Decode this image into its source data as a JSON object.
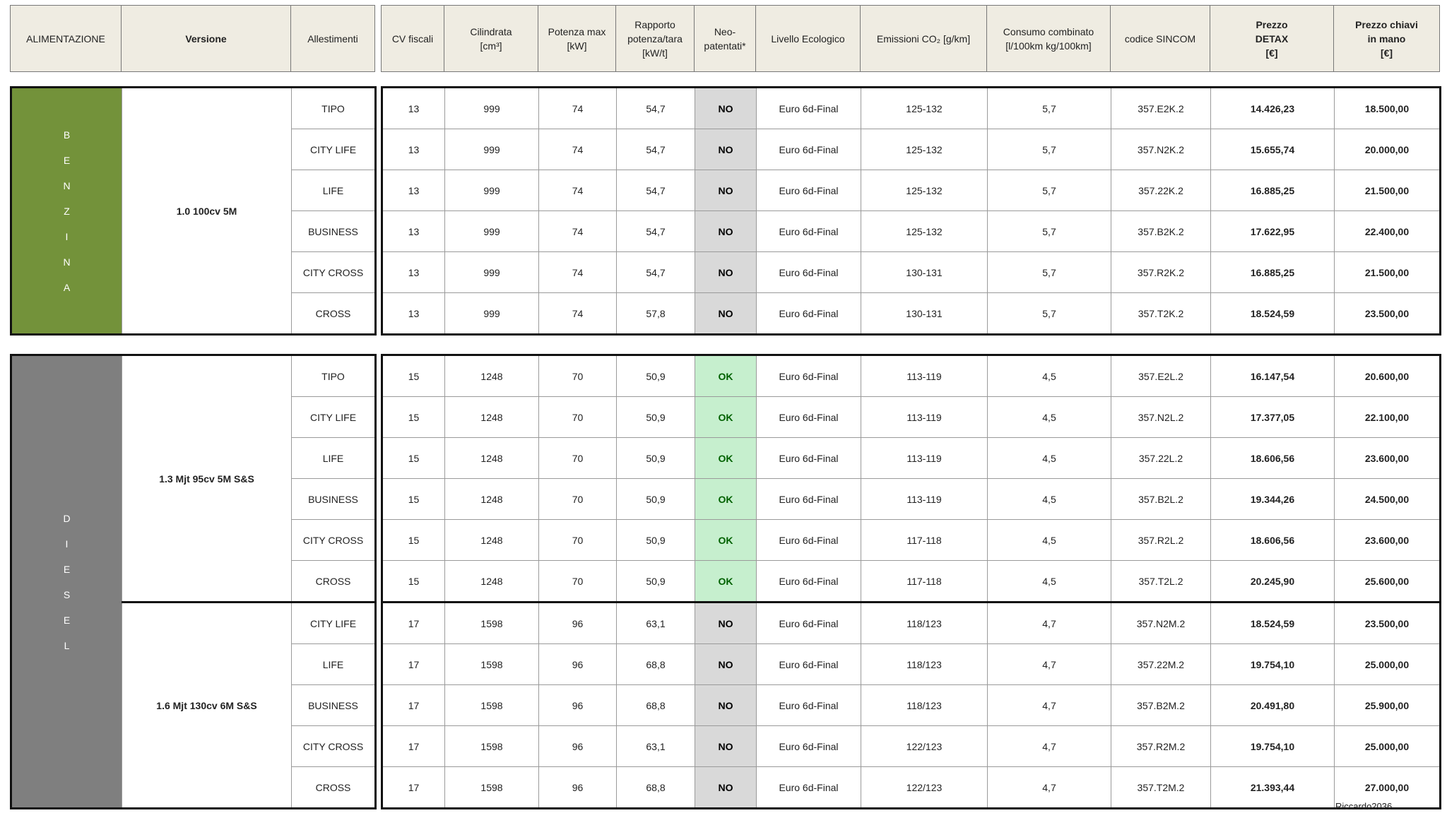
{
  "header": {
    "left": [
      "ALIMENTAZIONE",
      "Versione",
      "Allestimenti"
    ],
    "right": [
      {
        "lines": [
          "CV fiscali"
        ],
        "bold": false
      },
      {
        "lines": [
          "Cilindrata",
          "[cm³]"
        ],
        "bold": false
      },
      {
        "lines": [
          "Potenza max",
          "[kW]"
        ],
        "bold": false
      },
      {
        "lines": [
          "Rapporto",
          "potenza/tara",
          "[kW/t]"
        ],
        "bold": false
      },
      {
        "lines": [
          "Neo-",
          "patentati*"
        ],
        "bold": false
      },
      {
        "lines": [
          "Livello Ecologico"
        ],
        "bold": false
      },
      {
        "lines": [
          "Emissioni CO₂ [g/km]"
        ],
        "bold": false
      },
      {
        "lines": [
          "Consumo combinato",
          "[l/100km kg/100km]"
        ],
        "bold": false
      },
      {
        "lines": [
          "codice SINCOM"
        ],
        "bold": false
      },
      {
        "lines": [
          "Prezzo",
          "DETAX",
          "[€]"
        ],
        "bold": true
      },
      {
        "lines": [
          "Prezzo chiavi",
          "in mano",
          "[€]"
        ],
        "bold": true
      }
    ]
  },
  "groups": [
    {
      "fuel": "BENZINA",
      "fuel_color": "#73923a",
      "versions": [
        {
          "name": "1.0 100cv 5M",
          "rows": [
            {
              "trim": "TIPO",
              "cv": "13",
              "cc": "999",
              "kw": "74",
              "ratio": "54,7",
              "neo": "NO",
              "eco": "Euro 6d-Final",
              "co2": "125-132",
              "cons": "5,7",
              "sincom": "357.E2K.2",
              "detax": "14.426,23",
              "price": "18.500,00"
            },
            {
              "trim": "CITY LIFE",
              "cv": "13",
              "cc": "999",
              "kw": "74",
              "ratio": "54,7",
              "neo": "NO",
              "eco": "Euro 6d-Final",
              "co2": "125-132",
              "cons": "5,7",
              "sincom": "357.N2K.2",
              "detax": "15.655,74",
              "price": "20.000,00"
            },
            {
              "trim": "LIFE",
              "cv": "13",
              "cc": "999",
              "kw": "74",
              "ratio": "54,7",
              "neo": "NO",
              "eco": "Euro 6d-Final",
              "co2": "125-132",
              "cons": "5,7",
              "sincom": "357.22K.2",
              "detax": "16.885,25",
              "price": "21.500,00"
            },
            {
              "trim": "BUSINESS",
              "cv": "13",
              "cc": "999",
              "kw": "74",
              "ratio": "54,7",
              "neo": "NO",
              "eco": "Euro 6d-Final",
              "co2": "125-132",
              "cons": "5,7",
              "sincom": "357.B2K.2",
              "detax": "17.622,95",
              "price": "22.400,00"
            },
            {
              "trim": "CITY CROSS",
              "cv": "13",
              "cc": "999",
              "kw": "74",
              "ratio": "54,7",
              "neo": "NO",
              "eco": "Euro 6d-Final",
              "co2": "130-131",
              "cons": "5,7",
              "sincom": "357.R2K.2",
              "detax": "16.885,25",
              "price": "21.500,00"
            },
            {
              "trim": "CROSS",
              "cv": "13",
              "cc": "999",
              "kw": "74",
              "ratio": "57,8",
              "neo": "NO",
              "eco": "Euro 6d-Final",
              "co2": "130-131",
              "cons": "5,7",
              "sincom": "357.T2K.2",
              "detax": "18.524,59",
              "price": "23.500,00"
            }
          ]
        }
      ]
    },
    {
      "fuel": "DIESEL",
      "fuel_color": "#7f7f7f",
      "versions": [
        {
          "name": "1.3 Mjt 95cv 5M S&S",
          "rows": [
            {
              "trim": "TIPO",
              "cv": "15",
              "cc": "1248",
              "kw": "70",
              "ratio": "50,9",
              "neo": "OK",
              "eco": "Euro 6d-Final",
              "co2": "113-119",
              "cons": "4,5",
              "sincom": "357.E2L.2",
              "detax": "16.147,54",
              "price": "20.600,00"
            },
            {
              "trim": "CITY LIFE",
              "cv": "15",
              "cc": "1248",
              "kw": "70",
              "ratio": "50,9",
              "neo": "OK",
              "eco": "Euro 6d-Final",
              "co2": "113-119",
              "cons": "4,5",
              "sincom": "357.N2L.2",
              "detax": "17.377,05",
              "price": "22.100,00"
            },
            {
              "trim": "LIFE",
              "cv": "15",
              "cc": "1248",
              "kw": "70",
              "ratio": "50,9",
              "neo": "OK",
              "eco": "Euro 6d-Final",
              "co2": "113-119",
              "cons": "4,5",
              "sincom": "357.22L.2",
              "detax": "18.606,56",
              "price": "23.600,00"
            },
            {
              "trim": "BUSINESS",
              "cv": "15",
              "cc": "1248",
              "kw": "70",
              "ratio": "50,9",
              "neo": "OK",
              "eco": "Euro 6d-Final",
              "co2": "113-119",
              "cons": "4,5",
              "sincom": "357.B2L.2",
              "detax": "19.344,26",
              "price": "24.500,00"
            },
            {
              "trim": "CITY CROSS",
              "cv": "15",
              "cc": "1248",
              "kw": "70",
              "ratio": "50,9",
              "neo": "OK",
              "eco": "Euro 6d-Final",
              "co2": "117-118",
              "cons": "4,5",
              "sincom": "357.R2L.2",
              "detax": "18.606,56",
              "price": "23.600,00"
            },
            {
              "trim": "CROSS",
              "cv": "15",
              "cc": "1248",
              "kw": "70",
              "ratio": "50,9",
              "neo": "OK",
              "eco": "Euro 6d-Final",
              "co2": "117-118",
              "cons": "4,5",
              "sincom": "357.T2L.2",
              "detax": "20.245,90",
              "price": "25.600,00"
            }
          ]
        },
        {
          "name": "1.6 Mjt 130cv 6M S&S",
          "rows": [
            {
              "trim": "CITY LIFE",
              "cv": "17",
              "cc": "1598",
              "kw": "96",
              "ratio": "63,1",
              "neo": "NO",
              "eco": "Euro 6d-Final",
              "co2": "118/123",
              "cons": "4,7",
              "sincom": "357.N2M.2",
              "detax": "18.524,59",
              "price": "23.500,00"
            },
            {
              "trim": "LIFE",
              "cv": "17",
              "cc": "1598",
              "kw": "96",
              "ratio": "68,8",
              "neo": "NO",
              "eco": "Euro 6d-Final",
              "co2": "118/123",
              "cons": "4,7",
              "sincom": "357.22M.2",
              "detax": "19.754,10",
              "price": "25.000,00"
            },
            {
              "trim": "BUSINESS",
              "cv": "17",
              "cc": "1598",
              "kw": "96",
              "ratio": "68,8",
              "neo": "NO",
              "eco": "Euro 6d-Final",
              "co2": "118/123",
              "cons": "4,7",
              "sincom": "357.B2M.2",
              "detax": "20.491,80",
              "price": "25.900,00"
            },
            {
              "trim": "CITY CROSS",
              "cv": "17",
              "cc": "1598",
              "kw": "96",
              "ratio": "63,1",
              "neo": "NO",
              "eco": "Euro 6d-Final",
              "co2": "122/123",
              "cons": "4,7",
              "sincom": "357.R2M.2",
              "detax": "19.754,10",
              "price": "25.000,00"
            },
            {
              "trim": "CROSS",
              "cv": "17",
              "cc": "1598",
              "kw": "96",
              "ratio": "68,8",
              "neo": "NO",
              "eco": "Euro 6d-Final",
              "co2": "122/123",
              "cons": "4,7",
              "sincom": "357.T2M.2",
              "detax": "21.393,44",
              "price": "27.000,00"
            }
          ]
        }
      ]
    }
  ],
  "credit": "Riccardo2036"
}
